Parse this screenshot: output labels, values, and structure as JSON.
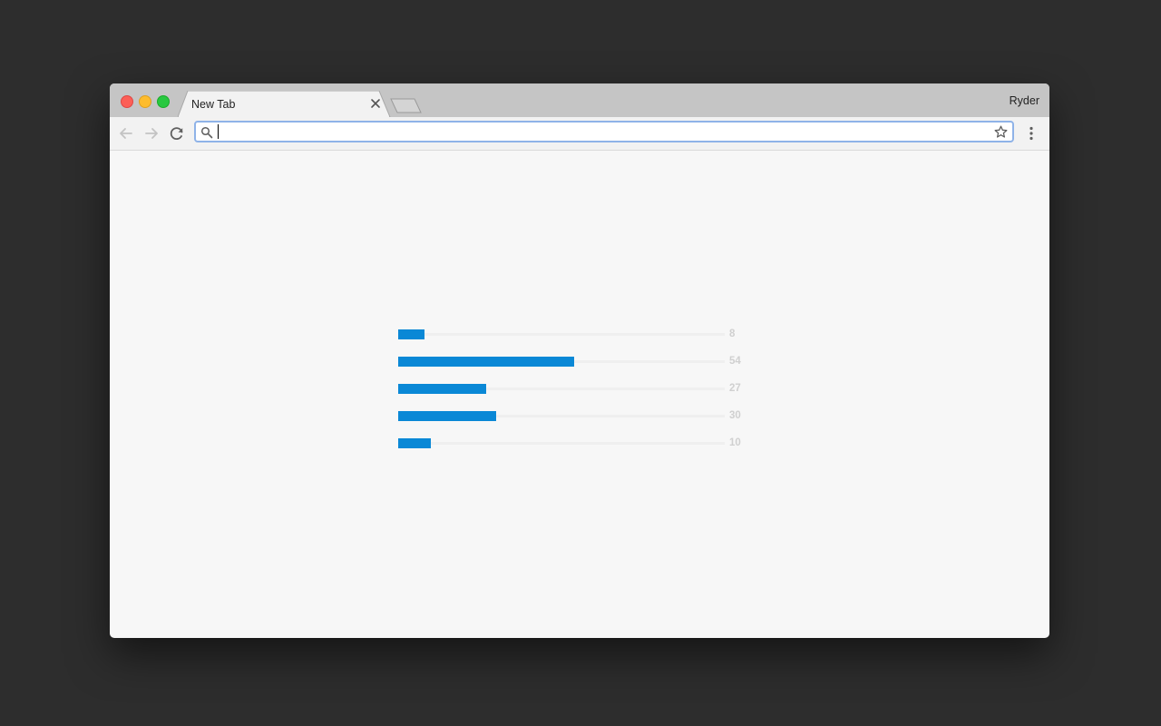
{
  "window": {
    "tab_title": "New Tab",
    "profile_name": "Ryder"
  },
  "toolbar": {
    "omnibox_value": "",
    "icons": [
      "back-arrow-icon",
      "forward-arrow-icon",
      "reload-icon",
      "search-icon",
      "star-icon",
      "more-vert-icon"
    ]
  },
  "colors": {
    "bar_fill": "#0a88d6",
    "bar_track": "#efefef",
    "value_text": "#d0d0d0",
    "omnibox_focus": "#8fb3e8"
  },
  "chart_data": {
    "type": "bar",
    "orientation": "horizontal",
    "values": [
      8,
      54,
      27,
      30,
      10
    ],
    "value_labels": [
      "8",
      "54",
      "27",
      "30",
      "10"
    ],
    "xlim": [
      0,
      100
    ],
    "grid": false
  }
}
